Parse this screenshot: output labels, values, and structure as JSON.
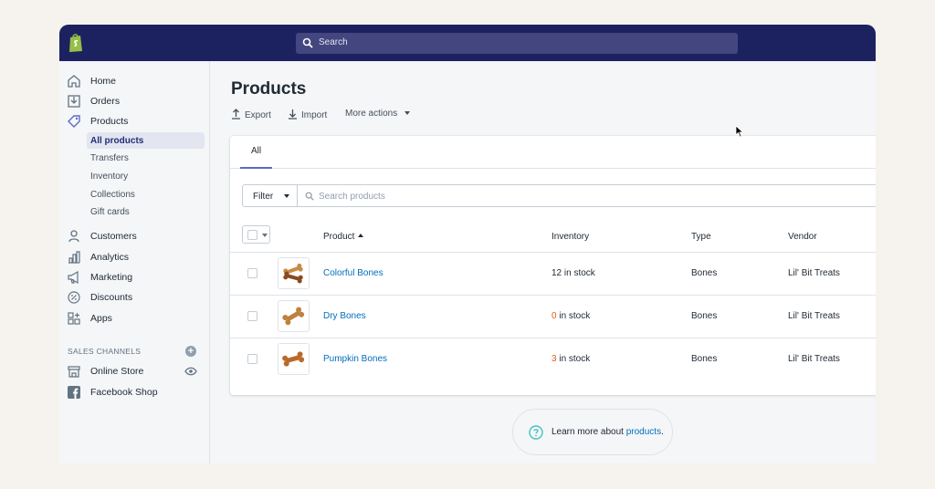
{
  "topbar": {
    "search_placeholder": "Search"
  },
  "sidebar": {
    "items": [
      {
        "label": "Home",
        "icon": "home-icon"
      },
      {
        "label": "Orders",
        "icon": "orders-icon"
      },
      {
        "label": "Products",
        "icon": "tag-icon"
      }
    ],
    "product_subitems": [
      {
        "label": "All products",
        "active": true
      },
      {
        "label": "Transfers",
        "active": false
      },
      {
        "label": "Inventory",
        "active": false
      },
      {
        "label": "Collections",
        "active": false
      },
      {
        "label": "Gift cards",
        "active": false
      }
    ],
    "items2": [
      {
        "label": "Customers",
        "icon": "customer-icon"
      },
      {
        "label": "Analytics",
        "icon": "analytics-icon"
      },
      {
        "label": "Marketing",
        "icon": "megaphone-icon"
      },
      {
        "label": "Discounts",
        "icon": "discount-icon"
      },
      {
        "label": "Apps",
        "icon": "apps-icon"
      }
    ],
    "channels_heading": "SALES CHANNELS",
    "channels": [
      {
        "label": "Online Store",
        "icon": "store-icon"
      },
      {
        "label": "Facebook Shop",
        "icon": "facebook-icon"
      }
    ]
  },
  "main": {
    "title": "Products",
    "actions": {
      "export": "Export",
      "import": "Import",
      "more": "More actions"
    },
    "tabs": [
      {
        "label": "All"
      }
    ],
    "filter_label": "Filter",
    "search_placeholder": "Search products",
    "columns": {
      "product": "Product",
      "inventory": "Inventory",
      "type": "Type",
      "vendor": "Vendor"
    },
    "rows": [
      {
        "name": "Colorful Bones",
        "inv_num": "12",
        "inv_suffix": " in stock",
        "low": false,
        "type": "Bones",
        "vendor": "Lil' Bit Treats"
      },
      {
        "name": "Dry Bones",
        "inv_num": "0",
        "inv_suffix": " in stock",
        "low": true,
        "type": "Bones",
        "vendor": "Lil' Bit Treats"
      },
      {
        "name": "Pumpkin Bones",
        "inv_num": "3",
        "inv_suffix": " in stock",
        "low": true,
        "type": "Bones",
        "vendor": "Lil' Bit Treats"
      }
    ],
    "learn_more": {
      "prefix": "Learn more about ",
      "link": "products",
      "suffix": "."
    }
  },
  "colors": {
    "topbar": "#1c2260",
    "link": "#006fbb",
    "warning": "#e35d16",
    "accent": "#5c6ac4"
  }
}
